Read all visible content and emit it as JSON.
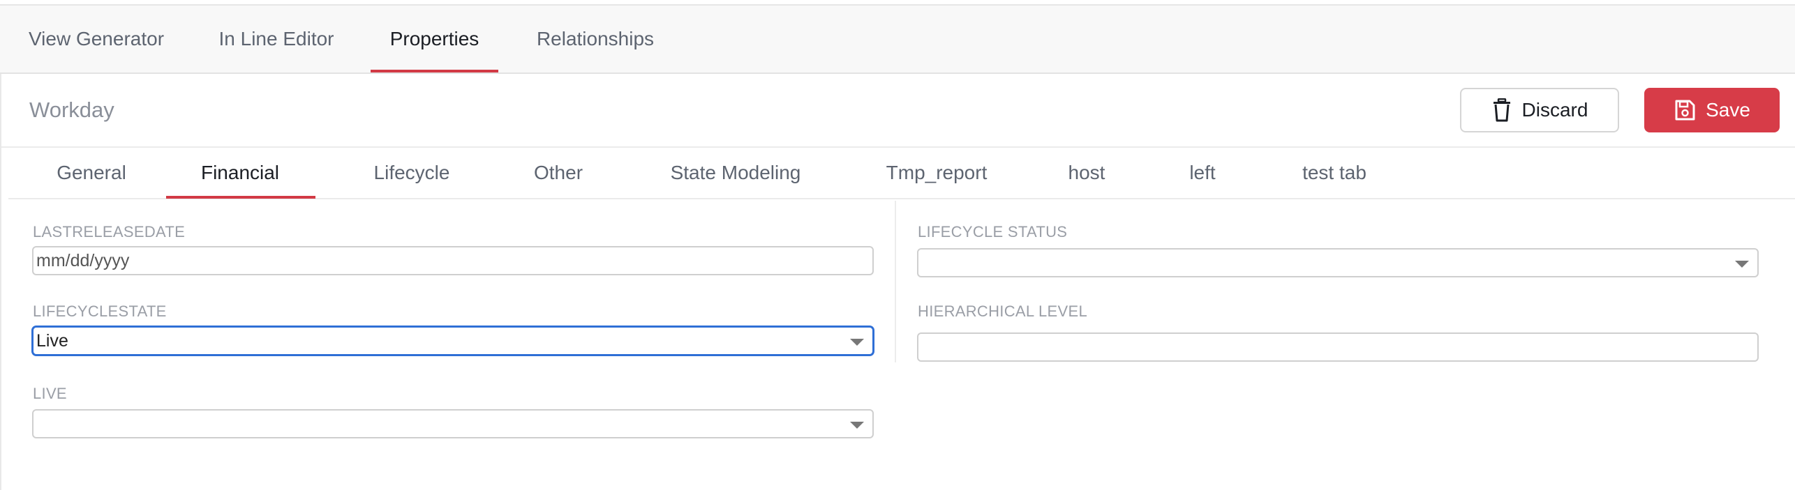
{
  "top_tabs": [
    {
      "label": "View Generator",
      "active": false
    },
    {
      "label": "In Line Editor",
      "active": false
    },
    {
      "label": "Properties",
      "active": true
    },
    {
      "label": "Relationships",
      "active": false
    }
  ],
  "header": {
    "title": "Workday",
    "discard_label": "Discard",
    "save_label": "Save",
    "discard_icon": "trash-icon",
    "save_icon": "floppy-disk-icon"
  },
  "sub_tabs": [
    {
      "label": "General",
      "active": false
    },
    {
      "label": "Financial",
      "active": true
    },
    {
      "label": "Lifecycle",
      "active": false
    },
    {
      "label": "Other",
      "active": false
    },
    {
      "label": "State Modeling",
      "active": false
    },
    {
      "label": "Tmp_report",
      "active": false
    },
    {
      "label": "host",
      "active": false
    },
    {
      "label": "left",
      "active": false
    },
    {
      "label": "test tab",
      "active": false
    }
  ],
  "form": {
    "lastreleasedate": {
      "label": "LASTRELEASEDATE",
      "placeholder": "mm/dd/yyyy",
      "value": ""
    },
    "lifecyclestate": {
      "label": "LIFECYCLESTATE",
      "value": "Live"
    },
    "live": {
      "label": "LIVE",
      "value": ""
    },
    "lifecycle_status": {
      "label": "LIFECYCLE STATUS",
      "value": ""
    },
    "hierarchical_level": {
      "label": "HIERARCHICAL LEVEL",
      "value": ""
    }
  },
  "colors": {
    "accent": "#d23a45",
    "save_button": "#d73c48",
    "focus_border": "#2f6fd6"
  }
}
